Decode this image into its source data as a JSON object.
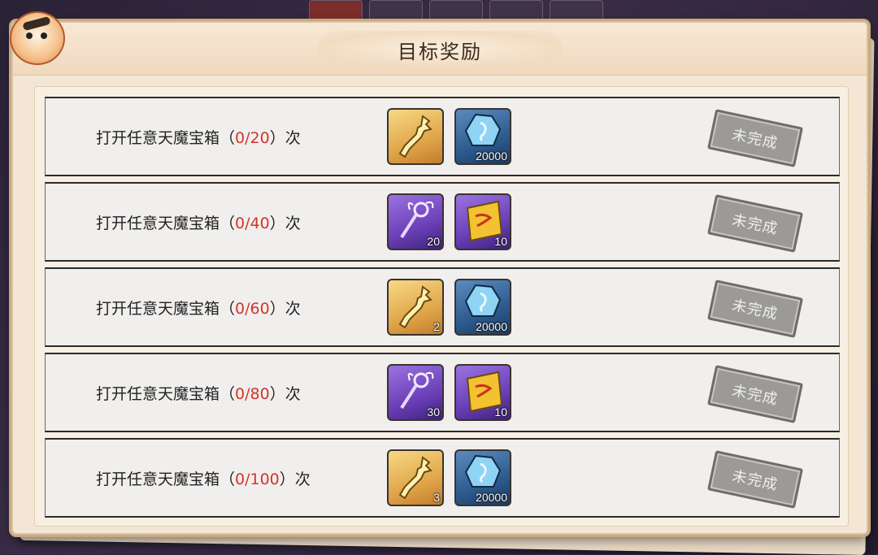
{
  "dialog": {
    "title": "目标奖励"
  },
  "tasks": [
    {
      "prefix": "打开任意天魔宝箱（",
      "count": "0/20",
      "suffix": "）次",
      "rewards": [
        {
          "icon": "gold-key-icon",
          "qty": ""
        },
        {
          "icon": "blue-crystal-icon",
          "qty": "20000"
        }
      ],
      "status": "未完成"
    },
    {
      "prefix": "打开任意天魔宝箱（",
      "count": "0/40",
      "suffix": "）次",
      "rewards": [
        {
          "icon": "purple-key-icon",
          "qty": "20"
        },
        {
          "icon": "scroll-ticket-icon",
          "qty": "10"
        }
      ],
      "status": "未完成"
    },
    {
      "prefix": "打开任意天魔宝箱（",
      "count": "0/60",
      "suffix": "）次",
      "rewards": [
        {
          "icon": "gold-key-icon",
          "qty": "2"
        },
        {
          "icon": "blue-crystal-icon",
          "qty": "20000"
        }
      ],
      "status": "未完成"
    },
    {
      "prefix": "打开任意天魔宝箱（",
      "count": "0/80",
      "suffix": "）次",
      "rewards": [
        {
          "icon": "purple-key-icon",
          "qty": "30"
        },
        {
          "icon": "scroll-ticket-icon",
          "qty": "10"
        }
      ],
      "status": "未完成"
    },
    {
      "prefix": "打开任意天魔宝箱（",
      "count": "0/100",
      "suffix": "）次",
      "rewards": [
        {
          "icon": "gold-key-icon",
          "qty": "3"
        },
        {
          "icon": "blue-crystal-icon",
          "qty": "20000"
        }
      ],
      "status": "未完成"
    }
  ],
  "colors": {
    "count": "#d0352c",
    "panel": "#f3e6d4",
    "row": "#f1efed",
    "stamp": "#9c9a97"
  }
}
